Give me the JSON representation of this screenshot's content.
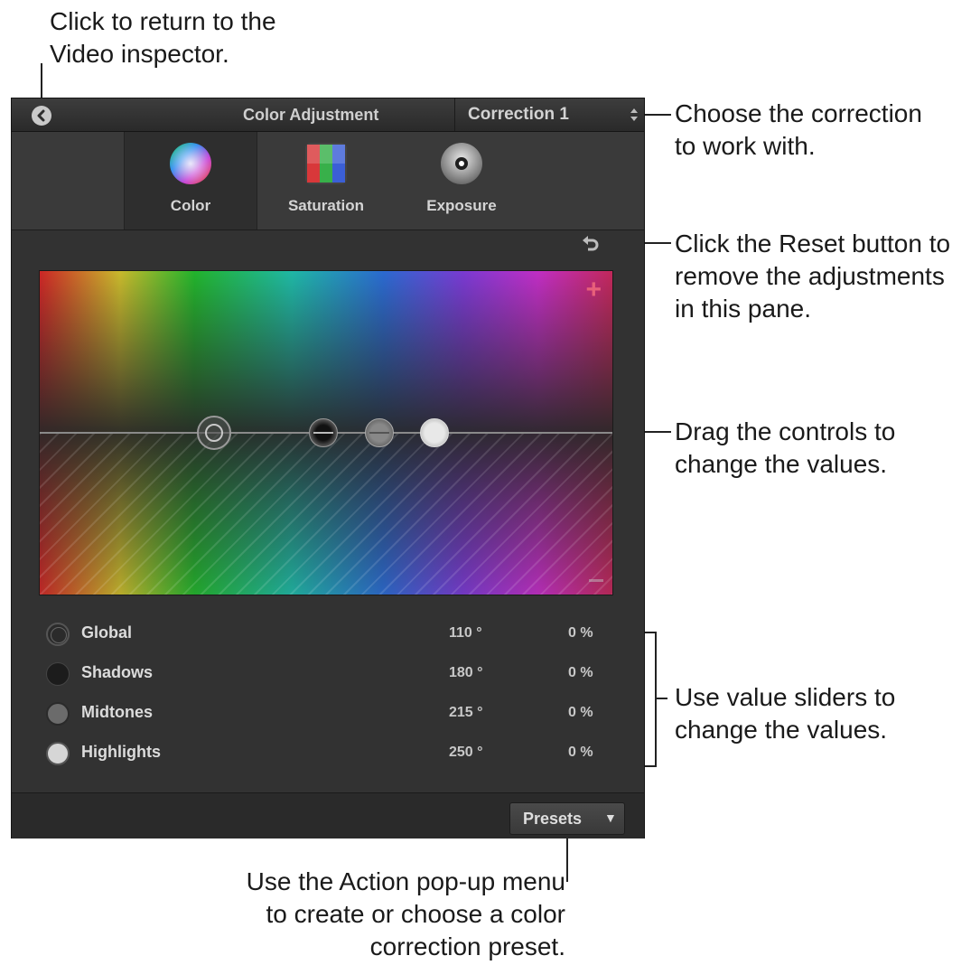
{
  "callouts": {
    "back": [
      "Click to return to the",
      "Video inspector."
    ],
    "correction": [
      "Choose the correction",
      "to work with."
    ],
    "reset": [
      "Click the Reset button to",
      "remove the adjustments",
      "in this pane."
    ],
    "drag": [
      "Drag the controls to",
      "change the values."
    ],
    "sliders": [
      "Use value sliders to",
      "change the values."
    ],
    "action": [
      "Use the Action pop-up menu",
      "to create or choose a color",
      "correction preset."
    ]
  },
  "panel": {
    "title": "Color Adjustment",
    "correction": "Correction 1",
    "tabs": [
      {
        "label": "Color",
        "icon": "color-wheel-icon"
      },
      {
        "label": "Saturation",
        "icon": "saturation-icon"
      },
      {
        "label": "Exposure",
        "icon": "exposure-icon"
      }
    ],
    "active_tab": "Color",
    "board_marks": {
      "plus": "+"
    },
    "controls": [
      {
        "name": "Global",
        "degrees": "110 °",
        "percent": "0 %"
      },
      {
        "name": "Shadows",
        "degrees": "180 °",
        "percent": "0 %"
      },
      {
        "name": "Midtones",
        "degrees": "215 °",
        "percent": "0 %"
      },
      {
        "name": "Highlights",
        "degrees": "250 °",
        "percent": "0 %"
      }
    ],
    "presets_label": "Presets",
    "presets_caret": "▼"
  },
  "colors": {
    "panel_bg": "#323232",
    "accent_plus": "#e8607a"
  }
}
